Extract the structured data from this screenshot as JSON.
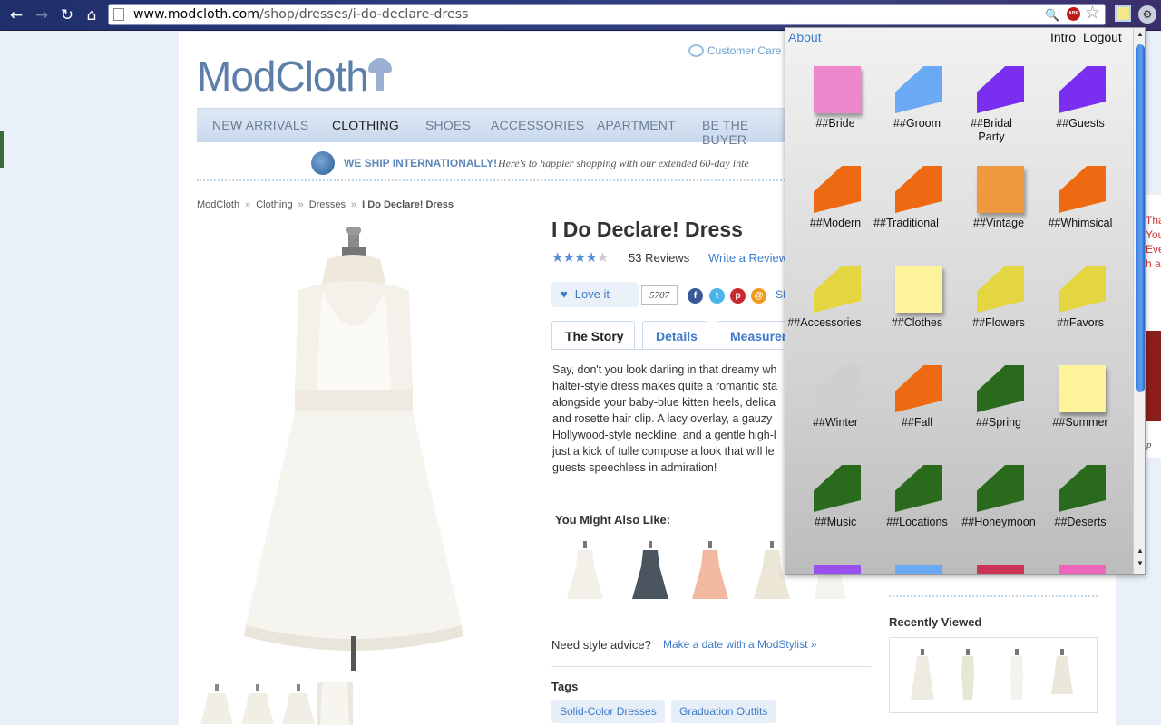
{
  "browser": {
    "url_domain": "www.modcloth.com",
    "url_path": "/shop/dresses/i-do-declare-dress",
    "back_icon": "back-arrow-icon",
    "forward_icon": "forward-arrow-icon",
    "reload_icon": "reload-icon",
    "home_icon": "home-icon",
    "abp_label": "ABP"
  },
  "site": {
    "logo": "ModCloth",
    "customer_care": "Customer Care",
    "nav": [
      "NEW ARRIVALS",
      "CLOTHING",
      "SHOES",
      "ACCESSORIES",
      "APARTMENT",
      "BE THE BUYER"
    ],
    "ship_bold": "WE SHIP INTERNATIONALLY!",
    "ship_italic": "Here's to happier shopping with our extended 60-day inte",
    "breadcrumbs": [
      "ModCloth",
      "Clothing",
      "Dresses",
      "I Do Declare! Dress"
    ],
    "breadcrumb_sep": "»"
  },
  "product": {
    "title": "I Do Declare! Dress",
    "rating": 4,
    "stars_max": 5,
    "reviews": "53 Reviews",
    "write_review": "Write a Review",
    "love_it": "Love it",
    "love_count": "5707",
    "share_label": "Sh",
    "tabs": [
      "The Story",
      "Details",
      "Measurem"
    ],
    "story_lines": [
      "Say, don't you look darling in that dreamy wh",
      "halter-style dress makes quite a romantic sta",
      "alongside your baby-blue kitten heels, delica",
      "and rosette hair clip. A lacy overlay, a gauzy",
      "Hollywood-style neckline, and a gentle high-l",
      "just a kick of tulle compose a look that will le",
      "guests speechless in admiration!"
    ],
    "ymal_title": "You Might Also Like:",
    "advice_q": "Need style advice?",
    "advice_link": "Make a date with a ModStylist »",
    "tags_title": "Tags",
    "tags": [
      "Solid-Color Dresses",
      "Graduation Outfits"
    ]
  },
  "sidebar": {
    "recently_viewed": "Recently Viewed",
    "side_text": [
      "Tha",
      "You",
      "Eve",
      "h a"
    ],
    "side_italic": "p"
  },
  "popup": {
    "about": "About",
    "intro": "Intro",
    "logout": "Logout",
    "notes": [
      {
        "label": "##Bride",
        "color": "#ee88cc",
        "folded": false
      },
      {
        "label": "##Groom",
        "color": "#6aaaf5",
        "folded": true
      },
      {
        "label": "##Bridal Party",
        "color": "#7a2ff0",
        "folded": true
      },
      {
        "label": "##Guests",
        "color": "#7a2ff0",
        "folded": true
      },
      {
        "label": "##Modern",
        "color": "#ee6a12",
        "folded": true
      },
      {
        "label": "##Traditional",
        "color": "#ee6a12",
        "folded": true
      },
      {
        "label": "##Vintage",
        "color": "#ee9840",
        "folded": false
      },
      {
        "label": "##Whimsical",
        "color": "#ee6a12",
        "folded": true
      },
      {
        "label": "##Accessories",
        "color": "#e4d640",
        "folded": true
      },
      {
        "label": "##Clothes",
        "color": "#fdf39a",
        "folded": false
      },
      {
        "label": "##Flowers",
        "color": "#e4d640",
        "folded": true
      },
      {
        "label": "##Favors",
        "color": "#e4d640",
        "folded": true
      },
      {
        "label": "##Winter",
        "color": "#cfcfcf",
        "folded": true
      },
      {
        "label": "##Fall",
        "color": "#ee6a12",
        "folded": true
      },
      {
        "label": "##Spring",
        "color": "#2a6a1c",
        "folded": true
      },
      {
        "label": "##Summer",
        "color": "#fdf39a",
        "folded": false
      },
      {
        "label": "##Music",
        "color": "#2a6a1c",
        "folded": true
      },
      {
        "label": "##Locations",
        "color": "#2a6a1c",
        "folded": true
      },
      {
        "label": "##Honeymoon",
        "color": "#2a6a1c",
        "folded": true
      },
      {
        "label": "##Deserts",
        "color": "#2a6a1c",
        "folded": true
      }
    ],
    "partial_notes": [
      {
        "color": "#9a4ff0"
      },
      {
        "color": "#6aaaf5"
      },
      {
        "color": "#cc3355"
      },
      {
        "color": "#ee66bb"
      }
    ]
  }
}
